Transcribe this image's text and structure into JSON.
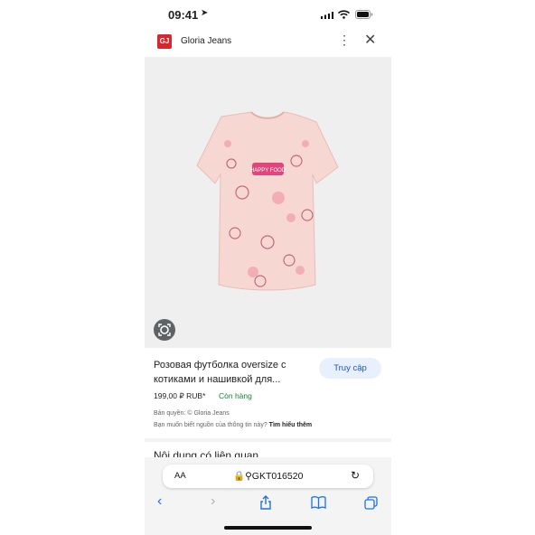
{
  "status": {
    "time": "09:41"
  },
  "header": {
    "logo_text": "GJ",
    "site_name": "Gloria Jeans"
  },
  "product": {
    "title": "Розовая футболка oversize с котиками и нашивкой для...",
    "visit_label": "Truy cập",
    "price": "199,00 ₽ RUB*",
    "stock": "Còn hàng",
    "copyright": "Bản quyền: © Gloria Jeans",
    "learn_question": "Bạn muốn biết nguồn của thông tin này?",
    "learn_link": "Tìm hiểu thêm",
    "patch_text": "HAPPY FOOD"
  },
  "related_heading": "Nội dung có liên quan",
  "browser": {
    "aa_label": "AA",
    "url_text": "GKT016520"
  },
  "colors": {
    "accent": "#1a73e8",
    "brand": "#d9262c",
    "in_stock": "#188038",
    "tshirt": "#f6d7d2"
  },
  "icons": [
    "location-arrow-icon",
    "signal-icon",
    "wifi-icon",
    "battery-icon",
    "more-vert-icon",
    "close-icon",
    "lens-icon",
    "lock-icon",
    "search-icon",
    "reload-icon",
    "back-icon",
    "forward-icon",
    "share-icon",
    "bookmarks-icon",
    "tabs-icon"
  ]
}
